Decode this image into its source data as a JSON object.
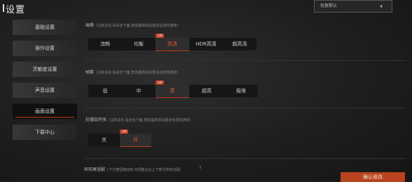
{
  "header": {
    "title": "设置",
    "restore_label": "恢复默认",
    "back_icon": "chevron-left-icon"
  },
  "sidebar": {
    "items": [
      {
        "label": "基础设置"
      },
      {
        "label": "操作设置"
      },
      {
        "label": "灵敏度设置"
      },
      {
        "label": "声音设置"
      },
      {
        "label": "画面设置"
      },
      {
        "label": "下载中心"
      }
    ],
    "active_index": 4
  },
  "sections": {
    "quality": {
      "label": "画质",
      "hint": "(注意设定,请点击下面,查找最高效设置适合您的游戏)",
      "options": [
        "流畅",
        "均衡",
        "高清",
        "HDR高清",
        "超高清"
      ],
      "selected": "高清",
      "badge": "当前"
    },
    "framerate": {
      "label": "帧数",
      "hint": "(注意设定,请点击下面,查找最高效设置适合您的游戏)",
      "options": [
        "低",
        "中",
        "高",
        "超高",
        "极限"
      ],
      "selected": "高",
      "badge": "当前"
    },
    "antialias": {
      "label": "抗锯齿开关",
      "hint": "(注意设定,请点击下面,查找最高效设置适合您的游戏)",
      "options": [
        "关",
        "开"
      ],
      "selected": "开",
      "badge": "当前"
    },
    "border": {
      "label": "异形屏适配",
      "hint": "(下方按钮拖动到,可调整左右上下部分所有边距)",
      "help": "?"
    }
  },
  "footer": {
    "apply_label": "确认修改"
  },
  "colors": {
    "accent": "#c0391b",
    "selected_text": "#ef5a2d"
  }
}
